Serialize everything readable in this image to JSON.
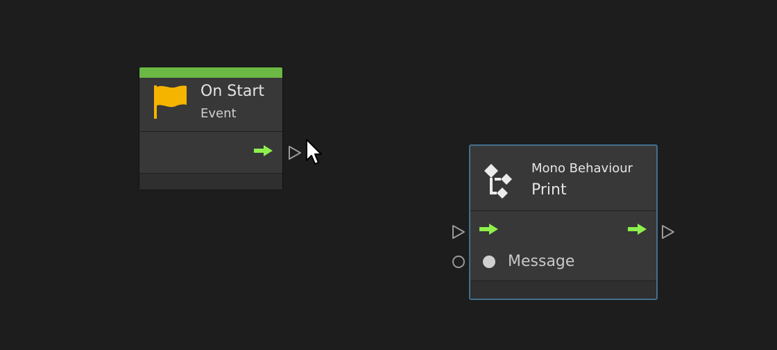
{
  "colors": {
    "background": "#1d1d1d",
    "node_body": "#383838",
    "event_bar": "#6cb844",
    "flow_arrow": "#8ef04c",
    "flag": "#f5b400",
    "selection_border": "#44708f"
  },
  "on_start_node": {
    "title": "On Start",
    "subtitle": "Event",
    "icon": "flag-icon"
  },
  "print_node": {
    "category": "Mono Behaviour",
    "title": "Print",
    "icon": "mono-behaviour-icon",
    "input_label": "Message"
  }
}
